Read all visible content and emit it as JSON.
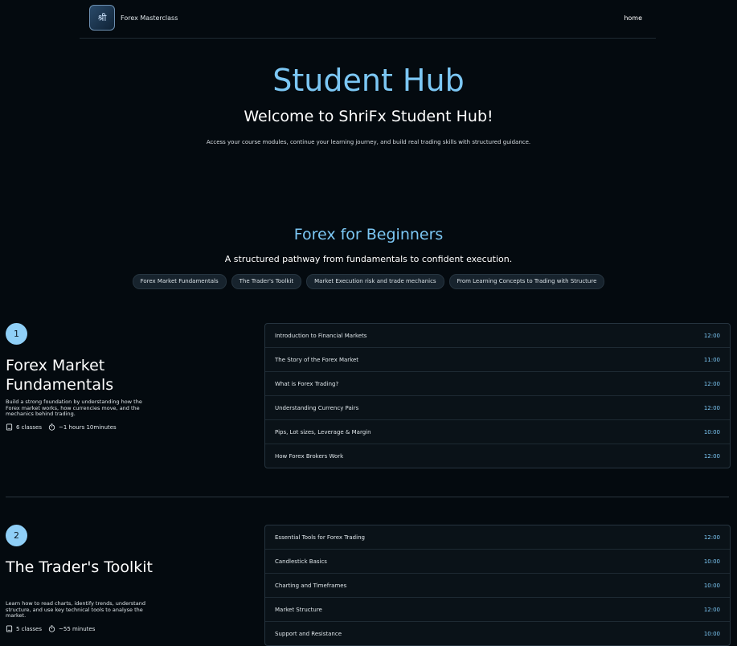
{
  "nav": {
    "brand": "Forex Masterclass",
    "home": "home",
    "logo_glyph": "श्री"
  },
  "hero": {
    "title": "Student Hub",
    "subtitle": "Welcome to ShriFx Student Hub!",
    "description": "Access your course modules, continue your learning journey, and build real trading skills with structured guidance."
  },
  "course": {
    "title": "Forex for Beginners",
    "subtitle": "A structured pathway from fundamentals to confident execution.",
    "chips": [
      "Forex Market Fundamentals",
      "The Trader's Toolkit",
      "Market Execution risk and trade mechanics",
      "From Learning Concepts to Trading with Structure"
    ]
  },
  "modules": [
    {
      "number": "1",
      "title": "Forex Market Fundamentals",
      "description": "Build a strong foundation by understanding how the Forex market works, how currencies move, and the mechanics behind trading.",
      "classes": "6 classes",
      "duration": "~1 hours 10minutes",
      "lessons": [
        {
          "title": "Introduction to Financial Markets",
          "time": "12:00"
        },
        {
          "title": "The Story of the Forex Market",
          "time": "11:00"
        },
        {
          "title": "What is Forex Trading?",
          "time": "12:00"
        },
        {
          "title": "Understanding Currency Pairs",
          "time": "12:00"
        },
        {
          "title": "Pips, Lot sizes, Leverage & Margin",
          "time": "10:00"
        },
        {
          "title": "How Forex Brokers Work",
          "time": "12:00"
        }
      ]
    },
    {
      "number": "2",
      "title": "The Trader's Toolkit",
      "description": "Learn how to read charts, identify trends, understand structure, and use key technical tools to analyse the market.",
      "classes": "5 classes",
      "duration": "~55 minutes",
      "lessons": [
        {
          "title": "Essential Tools for Forex Trading",
          "time": "12:00"
        },
        {
          "title": "Candlestick Basics",
          "time": "10:00"
        },
        {
          "title": "Charting and Timeframes",
          "time": "10:00"
        },
        {
          "title": "Market Structure",
          "time": "12:00"
        },
        {
          "title": "Support and Resistance",
          "time": "10:00"
        }
      ]
    }
  ]
}
